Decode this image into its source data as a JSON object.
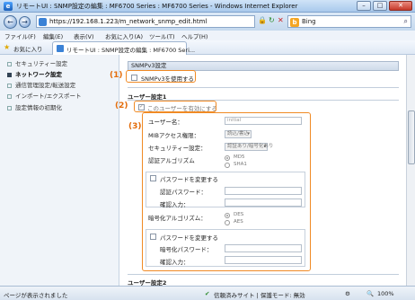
{
  "window": {
    "title": "リモートUI : SNMP設定の編集 : MF6700 Series : MF6700 Series - Windows Internet Explorer",
    "minimize": "–",
    "maximize": "□",
    "close": "✕"
  },
  "addressbar": {
    "url": "https://192.168.1.223/m_network_snmp_edit.html",
    "search_engine": "Bing",
    "back_icon": "←",
    "forward_icon": "→",
    "lock_icon": "🔒",
    "refresh_icon": "↻",
    "stop_icon": "✕",
    "search_icon": "⌕"
  },
  "menu": [
    "ファイル(F)",
    "編集(E)",
    "表示(V)",
    "お気に入り(A)",
    "ツール(T)",
    "ヘルプ(H)"
  ],
  "favorites": {
    "label": "お気に入り",
    "tab_title": "リモートUI : SNMP設定の編集 : MF6700 Seri..."
  },
  "sidebar": {
    "items": [
      {
        "label": "セキュリティー設定",
        "active": false
      },
      {
        "label": "ネットワーク設定",
        "active": true
      },
      {
        "label": "通信管理設定/転送設定",
        "active": false
      },
      {
        "label": "インポート/エクスポート",
        "active": false
      },
      {
        "label": "設定情報の初期化",
        "active": false
      }
    ]
  },
  "main": {
    "snmpv3_head": "SNMPv3設定",
    "use_snmpv3": "SNMPv3を使用する",
    "user1_head": "ユーザー設定1",
    "enable_user": "このユーザーを有効にする",
    "username_label": "ユーザー名：",
    "username_value": "initial",
    "mib_label": "MIBアクセス権限：",
    "mib_value": "読込/書込",
    "security_label": "セキュリティー設定：",
    "security_value": "認証あり/暗号化あり",
    "auth_algo_label": "認証アルゴリズム",
    "auth_opt1": "MD5",
    "auth_opt2": "SHA1",
    "change_password": "パスワードを変更する",
    "auth_password_label": "認証パスワード：",
    "confirm_label": "確認入力：",
    "enc_algo_label": "暗号化アルゴリズム：",
    "enc_opt1": "DES",
    "enc_opt2": "AES",
    "change_password2": "パスワードを変更する",
    "enc_password_label": "暗号化パスワード：",
    "confirm_label2": "確認入力：",
    "user2_head": "ユーザー設定2"
  },
  "callouts": [
    "(1)",
    "(2)",
    "(3)"
  ],
  "status": {
    "left": "ページが表示されました",
    "zone": "信頼済みサイト | 保護モード: 無効",
    "zoom": "100%"
  },
  "colors": {
    "callout": "#e36c0a",
    "frame": "#f08a24"
  }
}
